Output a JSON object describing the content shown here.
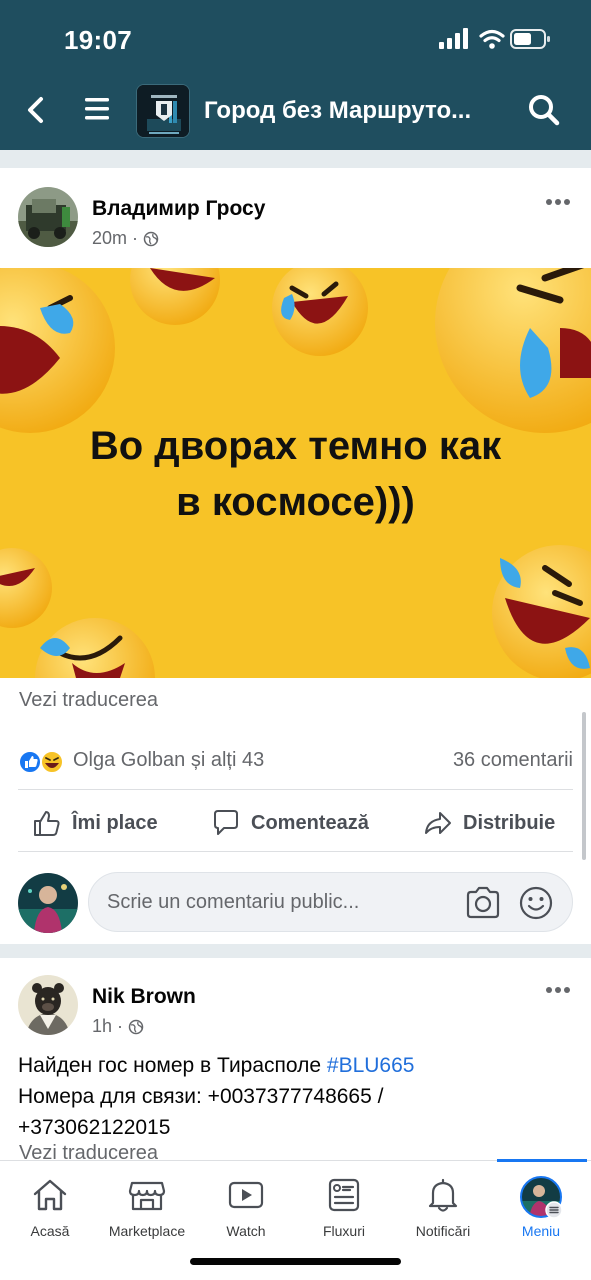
{
  "status_bar": {
    "time": "19:07"
  },
  "header": {
    "title": "Город без Маршруто...",
    "icons": [
      "back-icon",
      "menu-icon",
      "search-icon"
    ]
  },
  "post1": {
    "author": "Владимир Гросу",
    "time": "20m",
    "privacy_icon": "globe-icon",
    "image_text": "Во дворах темно как\nв космосе)))",
    "see_translation": "Vezi traducerea",
    "reactions": "Olga Golban și alți 43",
    "reaction_icons": [
      "like-icon",
      "haha-icon"
    ],
    "comments": "36 comentarii",
    "actions": {
      "like": "Îmi place",
      "comment": "Comentează",
      "share": "Distribuie"
    },
    "comment_placeholder": "Scrie un comentariu public..."
  },
  "post2": {
    "author": "Nik Brown",
    "time": "1h",
    "privacy_icon": "globe-icon",
    "text_line1": "Найден гос номер в Тирасполе ",
    "hashtag": "#BLU665",
    "text_line2": "Номера для связи: +0037377748665 /",
    "text_line3": "+373062122015",
    "see_translation": "Vezi traducerea"
  },
  "bottom_nav": {
    "tabs": [
      {
        "label": "Acasă",
        "icon": "home-icon"
      },
      {
        "label": "Marketplace",
        "icon": "marketplace-icon"
      },
      {
        "label": "Watch",
        "icon": "watch-icon"
      },
      {
        "label": "Fluxuri",
        "icon": "feeds-icon"
      },
      {
        "label": "Notificări",
        "icon": "bell-icon"
      },
      {
        "label": "Meniu",
        "icon": "profile-avatar"
      }
    ],
    "active": "Meniu"
  },
  "colors": {
    "header_bg": "#1f4e5f",
    "accent": "#1877f2",
    "image_bg": "#f7c327",
    "hashtag": "#216fdb"
  }
}
